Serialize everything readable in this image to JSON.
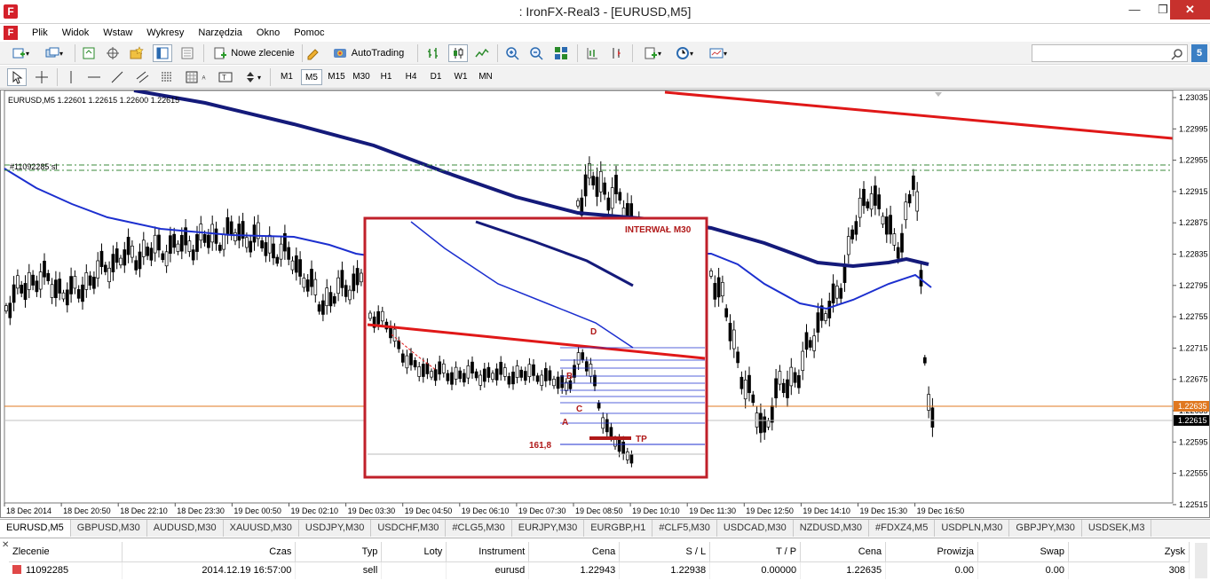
{
  "window": {
    "title": ": IronFX-Real3 - [EURUSD,M5]",
    "app_icon": "F",
    "min": "—",
    "max": "❐",
    "close": "✕"
  },
  "menu": {
    "items": [
      "Plik",
      "Widok",
      "Wstaw",
      "Wykresy",
      "Narzędzia",
      "Okno",
      "Pomoc"
    ],
    "mdi": [
      "–",
      "❐",
      "✕"
    ]
  },
  "toolbar": {
    "new_order": "Nowe zlecenie",
    "autotrading": "AutoTrading",
    "notifications_count": "5"
  },
  "timeframes": [
    "M1",
    "M5",
    "M15",
    "M30",
    "H1",
    "H4",
    "D1",
    "W1",
    "MN"
  ],
  "active_timeframe": "M5",
  "chart": {
    "header": "EURUSD,M5  1.22601 1.22615 1.22600 1.22615",
    "order_label": "#11092285 sl",
    "price_axis": [
      "1.23035",
      "1.22995",
      "1.22955",
      "1.22915",
      "1.22875",
      "1.22835",
      "1.22795",
      "1.22755",
      "1.22715",
      "1.22675",
      "1.22635",
      "1.22595",
      "1.22555",
      "1.22515"
    ],
    "current_bid": "1.22615",
    "orange_level": "1.22635",
    "time_axis": [
      "18 Dec 2014",
      "18 Dec 20:50",
      "18 Dec 22:10",
      "18 Dec 23:30",
      "19 Dec 00:50",
      "19 Dec 02:10",
      "19 Dec 03:30",
      "19 Dec 04:50",
      "19 Dec 06:10",
      "19 Dec 07:30",
      "19 Dec 08:50",
      "19 Dec 10:10",
      "19 Dec 11:30",
      "19 Dec 12:50",
      "19 Dec 14:10",
      "19 Dec 15:30",
      "19 Dec 16:50"
    ],
    "inset": {
      "title": "INTERWAŁ M30",
      "fib_label": "161,8",
      "tp_label": "TP",
      "points": [
        "A",
        "B",
        "C",
        "D"
      ]
    },
    "colors": {
      "trendline": "#e01818",
      "ma_fast": "#1c2fcf",
      "ma_slow": "#141a7a",
      "order_line": "#3a8a3a",
      "orange_line": "#e07820",
      "inset_border": "#c0202a",
      "candles": "#000000"
    }
  },
  "symbol_tabs": [
    "EURUSD,M5",
    "GBPUSD,M30",
    "AUDUSD,M30",
    "XAUUSD,M30",
    "USDJPY,M30",
    "USDCHF,M30",
    "#CLG5,M30",
    "EURJPY,M30",
    "EURGBP,H1",
    "#CLF5,M30",
    "USDCAD,M30",
    "NZDUSD,M30",
    "#FDXZ4,M5",
    "USDPLN,M30",
    "GBPJPY,M30",
    "USDSEK,M3"
  ],
  "orders": {
    "headers": [
      "Zlecenie",
      "Czas",
      "Typ",
      "Loty",
      "Instrument",
      "Cena",
      "S / L",
      "T / P",
      "Cena",
      "Prowizja",
      "Swap",
      "Zysk"
    ],
    "rows": [
      [
        "11092285",
        "2014.12.19 16:57:00",
        "sell",
        "",
        "eurusd",
        "1.22943",
        "1.22938",
        "0.00000",
        "1.22635",
        "0.00",
        "0.00",
        "308"
      ]
    ]
  }
}
